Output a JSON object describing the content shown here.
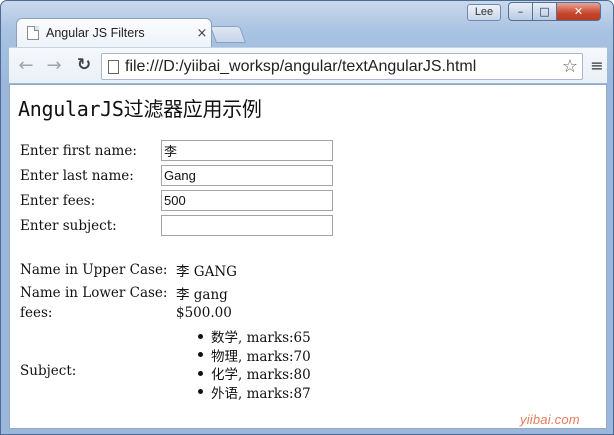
{
  "window": {
    "user_badge": "Lee",
    "minimize_symbol": "–",
    "maximize_symbol": "□",
    "close_symbol": "✕"
  },
  "tab": {
    "title": "Angular JS Filters",
    "close_symbol": "×"
  },
  "toolbar": {
    "back_symbol": "←",
    "forward_symbol": "→",
    "reload_symbol": "↻",
    "url": "file:///D:/yiibai_worksp/angular/textAngularJS.html",
    "star_symbol": "☆",
    "menu_symbol": "≡"
  },
  "page": {
    "title": "AngularJS过滤器应用示例",
    "form": [
      {
        "label": "Enter first name:",
        "value": "李"
      },
      {
        "label": "Enter last name:",
        "value": "Gang"
      },
      {
        "label": "Enter fees:",
        "value": "500"
      },
      {
        "label": "Enter subject:",
        "value": ""
      }
    ],
    "outputs": [
      {
        "label": "Name in Upper Case:",
        "value": "李 GANG"
      },
      {
        "label": "Name in Lower Case:",
        "value": "李 gang"
      },
      {
        "label": "fees:",
        "value": "$500.00"
      }
    ],
    "subject_label": "Subject:",
    "subjects": [
      "数学, marks:65",
      "物理, marks:70",
      "化学, marks:80",
      "外语, marks:87"
    ],
    "watermark": "yiibai.com"
  },
  "icons": {
    "tab_page": "page-icon",
    "omnibox_doc": "document-icon",
    "star": "star-icon",
    "menu": "hamburger-menu-icon"
  },
  "colors": {
    "frame": "#a9c3e2",
    "close_button": "#c7462d",
    "watermark": "#e77b5c"
  }
}
